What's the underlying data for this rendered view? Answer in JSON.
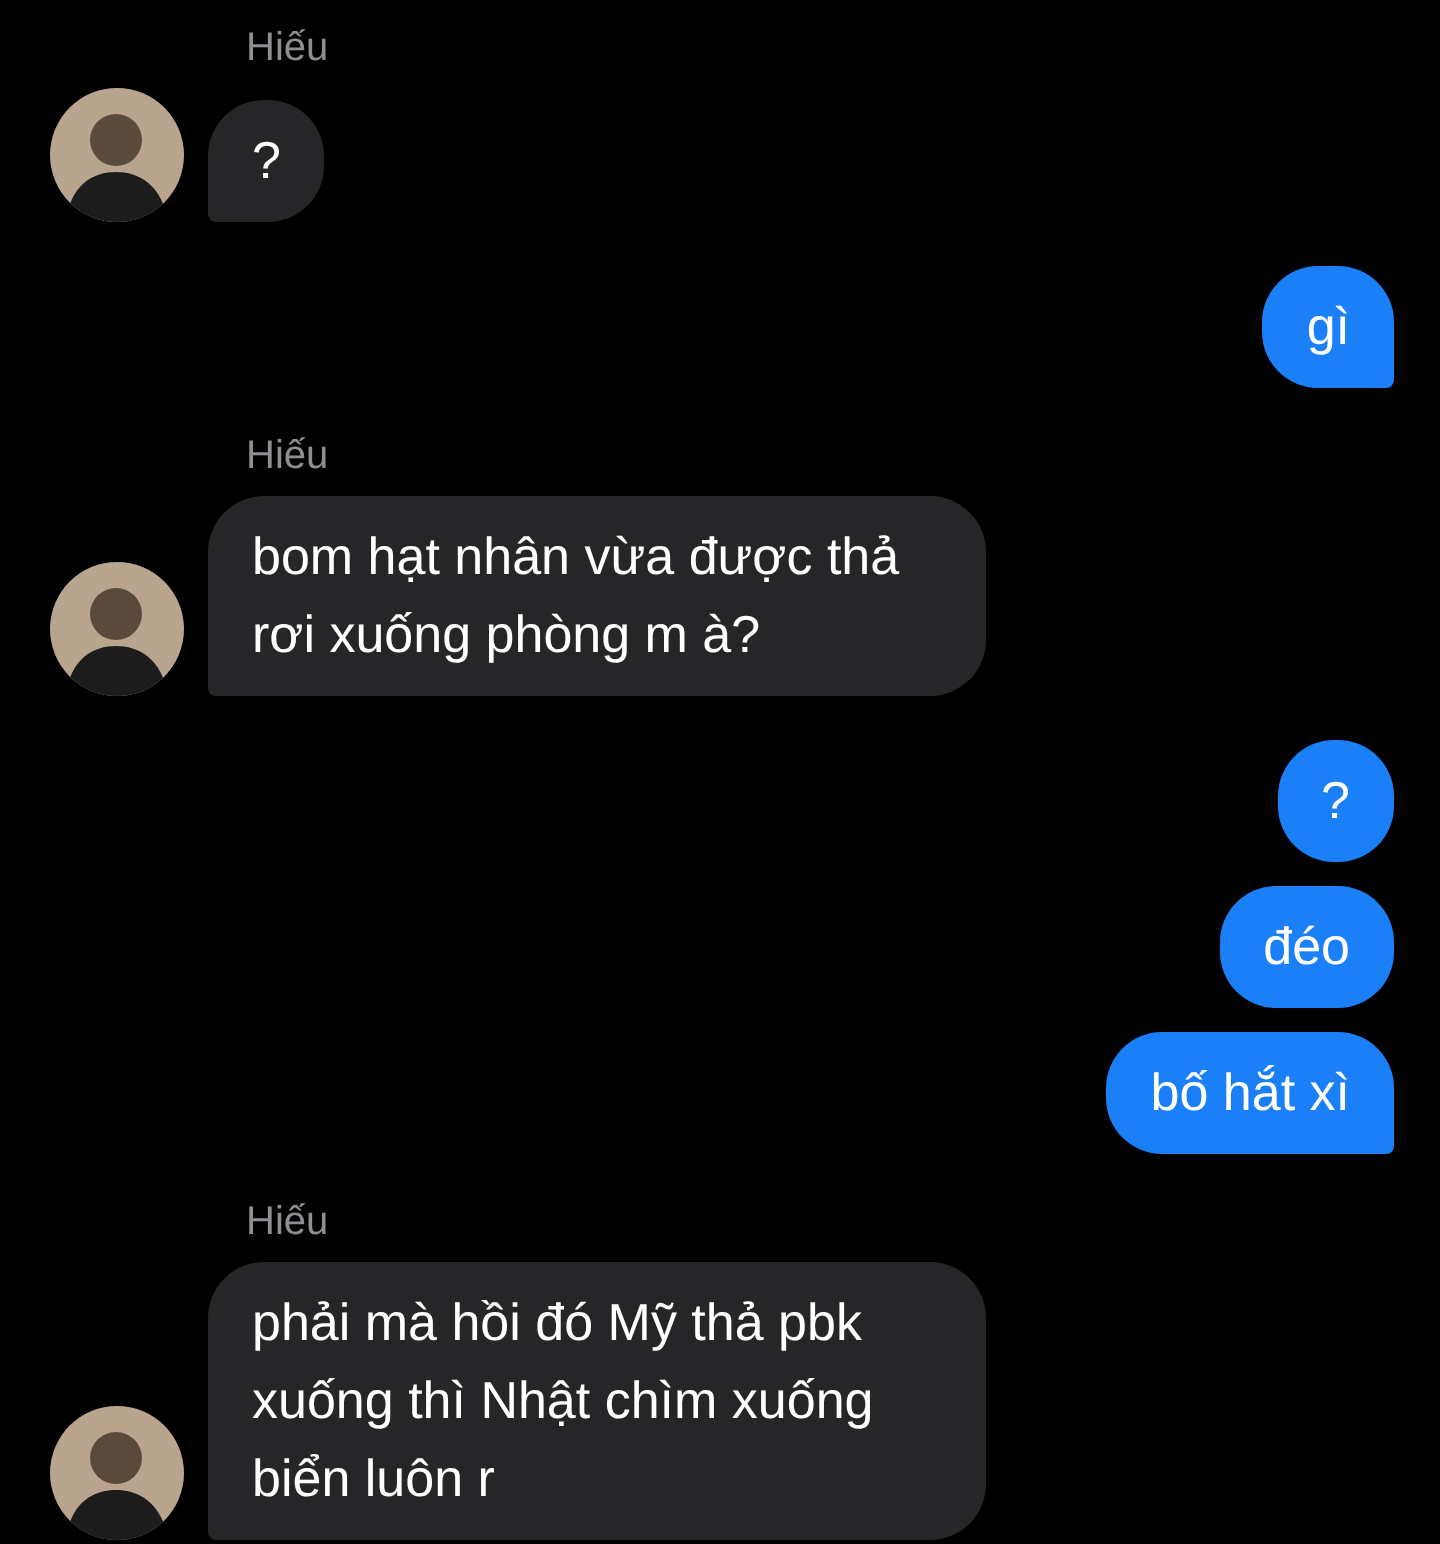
{
  "groups": [
    {
      "kind": "incoming",
      "sender": "Hiếu",
      "messages": [
        "?"
      ]
    },
    {
      "kind": "outgoing",
      "messages": [
        "gì"
      ]
    },
    {
      "kind": "incoming",
      "sender": "Hiếu",
      "messages": [
        "bom hạt nhân vừa được thả rơi xuống phòng m à?"
      ]
    },
    {
      "kind": "outgoing",
      "messages": [
        "?",
        "đéo",
        "bố hắt xì"
      ]
    },
    {
      "kind": "incoming",
      "sender": "Hiếu",
      "messages": [
        "phải mà hồi đó Mỹ thả pbk xuống thì Nhật chìm xuống biển luôn r"
      ]
    }
  ]
}
